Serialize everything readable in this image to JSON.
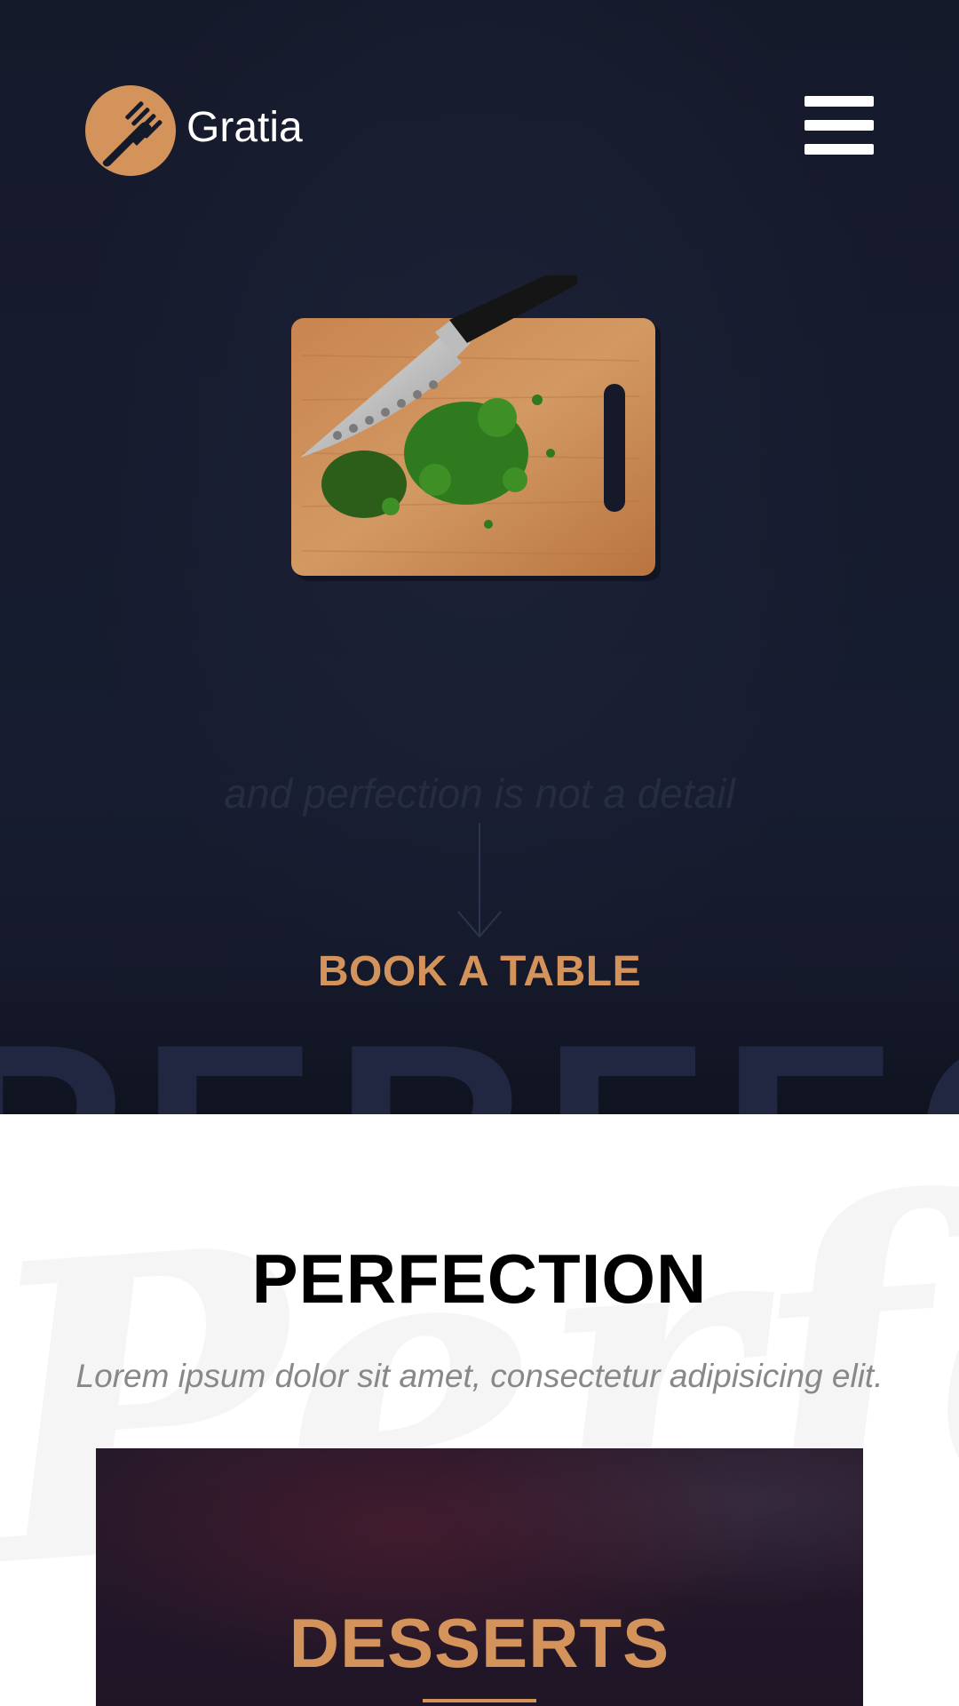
{
  "brand": {
    "name": "Gratia",
    "logo_icon": "fork-icon",
    "accent_color": "#d4935a"
  },
  "header": {
    "menu_icon": "hamburger-menu-icon"
  },
  "hero": {
    "illustration": "cutting-board-with-knife-and-herbs",
    "tagline": "and perfection is not a detail",
    "cta_label": "BOOK A TABLE",
    "background_word": "PERFECTION",
    "background_color": "#151a2b"
  },
  "about": {
    "title": "PERFECTION",
    "subtitle": "Lorem ipsum dolor sit amet, consectetur adipisicing elit.",
    "script_background": "Perfection"
  },
  "card": {
    "title": "DESSERTS"
  }
}
